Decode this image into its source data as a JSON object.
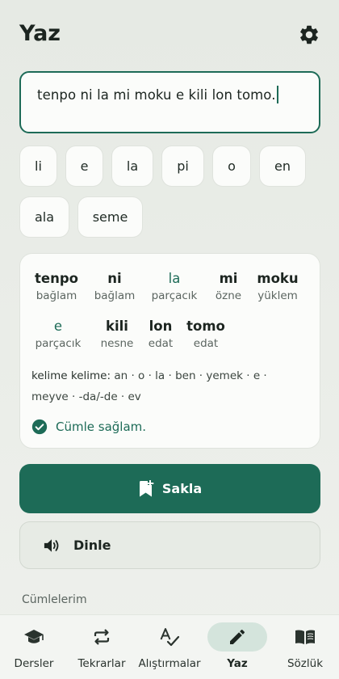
{
  "header": {
    "title": "Yaz",
    "settings_icon": "gear-icon"
  },
  "composer": {
    "text": "tenpo ni la mi moku e kili lon tomo."
  },
  "suggestions": [
    "li",
    "e",
    "la",
    "pi",
    "o",
    "en",
    "ala",
    "seme"
  ],
  "analysis": {
    "words": [
      {
        "word": "tenpo",
        "role": "bağlam"
      },
      {
        "word": "ni",
        "role": "bağlam"
      },
      {
        "word": "la",
        "role": "parçacık",
        "particle": true
      },
      {
        "word": "mi",
        "role": "özne"
      },
      {
        "word": "moku",
        "role": "yüklem"
      },
      {
        "word": "e",
        "role": "parçacık",
        "particle": true
      },
      {
        "word": "kili",
        "role": "nesne"
      },
      {
        "word": "lon",
        "role": "edat"
      },
      {
        "word": "tomo",
        "role": "edat"
      }
    ],
    "gloss_label": "kelime kelime:",
    "gloss_text": "an · o · la · ben · yemek · e · meyve · -da/-de · ev",
    "status": "Cümle sağlam.",
    "status_icon": "check-circle-icon"
  },
  "actions": {
    "save_label": "Sakla",
    "save_icon": "bookmark-plus-icon",
    "listen_label": "Dinle",
    "listen_icon": "speaker-icon"
  },
  "section_title": "Cümlelerim",
  "nav": {
    "active": "Yaz",
    "items": [
      {
        "label": "Dersler",
        "icon": "graduation-cap-icon"
      },
      {
        "label": "Tekrarlar",
        "icon": "repeat-icon"
      },
      {
        "label": "Alıştırmalar",
        "icon": "spellcheck-icon"
      },
      {
        "label": "Yaz",
        "icon": "pencil-icon"
      },
      {
        "label": "Sözlük",
        "icon": "book-icon"
      }
    ]
  },
  "colors": {
    "accent": "#1d6b57",
    "background": "#e9ece7",
    "card": "#fbfcfa"
  }
}
